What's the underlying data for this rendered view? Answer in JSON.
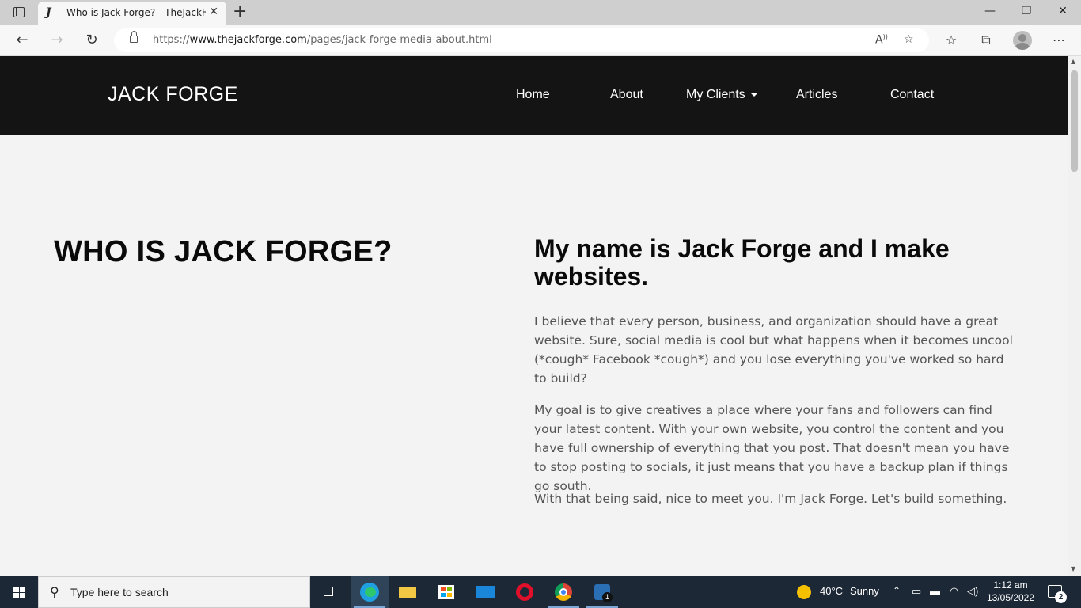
{
  "browser": {
    "tab_title": "Who is Jack Forge? - TheJackForge",
    "tab_favicon": "J",
    "tab_close": "✕",
    "new_tab": "+",
    "url_scheme": "https://",
    "url_host": "www.thejackforge.com",
    "url_path": "/pages/jack-forge-media-about.html",
    "icons": [
      "tab-actions-icon",
      "back-icon",
      "forward-icon",
      "refresh-icon",
      "lock-icon",
      "read-aloud-icon",
      "add-favorite-icon",
      "favorites-icon",
      "collections-icon",
      "profile-icon",
      "more-icon",
      "minimize-icon",
      "restore-icon",
      "close-window-icon"
    ]
  },
  "site": {
    "brand": "JACK FORGE",
    "nav": {
      "home": "Home",
      "about": "About",
      "clients": "My Clients",
      "articles": "Articles",
      "contact": "Contact"
    },
    "heading_left": "WHO IS JACK FORGE?",
    "heading_right": "My name is Jack Forge and I make websites.",
    "paragraphs": [
      "I believe that every person, business, and organization should have a great website. Sure, social media is cool but what happens when it becomes uncool (*cough* Facebook *cough*) and you lose everything you've worked so hard to build?",
      "My goal is to give creatives a place where your fans and followers can find your latest content. With your own website, you control the content and you have full ownership of everything that you post. That doesn't mean you have to stop posting to socials, it just means that you have a backup plan if things go south.",
      "With that being said, nice to meet you. I'm Jack Forge. Let's build something."
    ]
  },
  "taskbar": {
    "search_placeholder": "Type here to search",
    "weather_temp": "40°C",
    "weather_text": "Sunny",
    "time": "1:12 am",
    "date": "13/05/2022",
    "notification_count": "2",
    "mail_badge": "1",
    "apps": [
      "task-view-icon",
      "edge-icon",
      "file-explorer-icon",
      "store-icon",
      "mail-icon",
      "opera-icon",
      "chrome-icon",
      "app-icon"
    ]
  },
  "colors": {
    "site_nav_bg": "#141414",
    "page_bg": "#f3f3f3",
    "taskbar_bg": "#1c2836",
    "body_text": "#555555"
  }
}
